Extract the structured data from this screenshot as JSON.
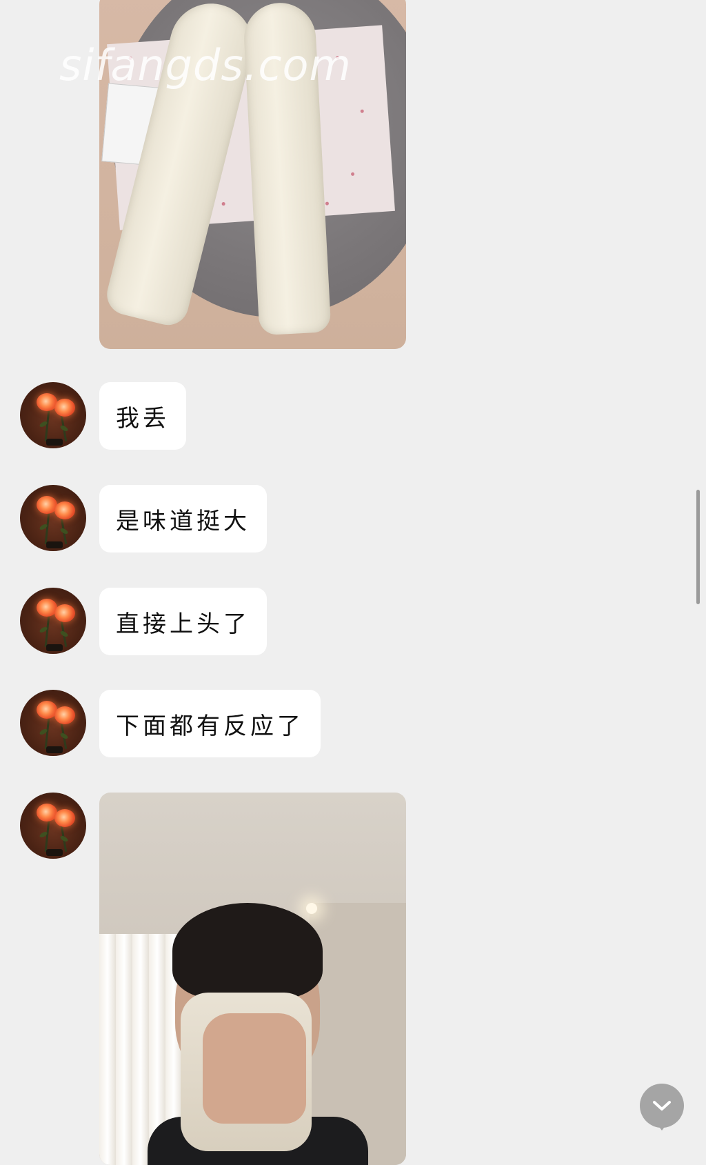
{
  "messages": [
    {
      "type": "image",
      "content": "photo",
      "watermark": "sifangds.com"
    },
    {
      "type": "text",
      "text": "我丢"
    },
    {
      "type": "text",
      "text": "是味道挺大"
    },
    {
      "type": "text",
      "text": "直接上头了"
    },
    {
      "type": "text",
      "text": "下面都有反应了"
    },
    {
      "type": "image",
      "content": "photo"
    }
  ],
  "icons": {
    "scroll_down": "chevron-down-icon",
    "avatar": "rose-avatar"
  },
  "colors": {
    "background": "#efefef",
    "bubble": "#ffffff",
    "text": "#111111",
    "scroll_button": "#a5a5a5"
  }
}
